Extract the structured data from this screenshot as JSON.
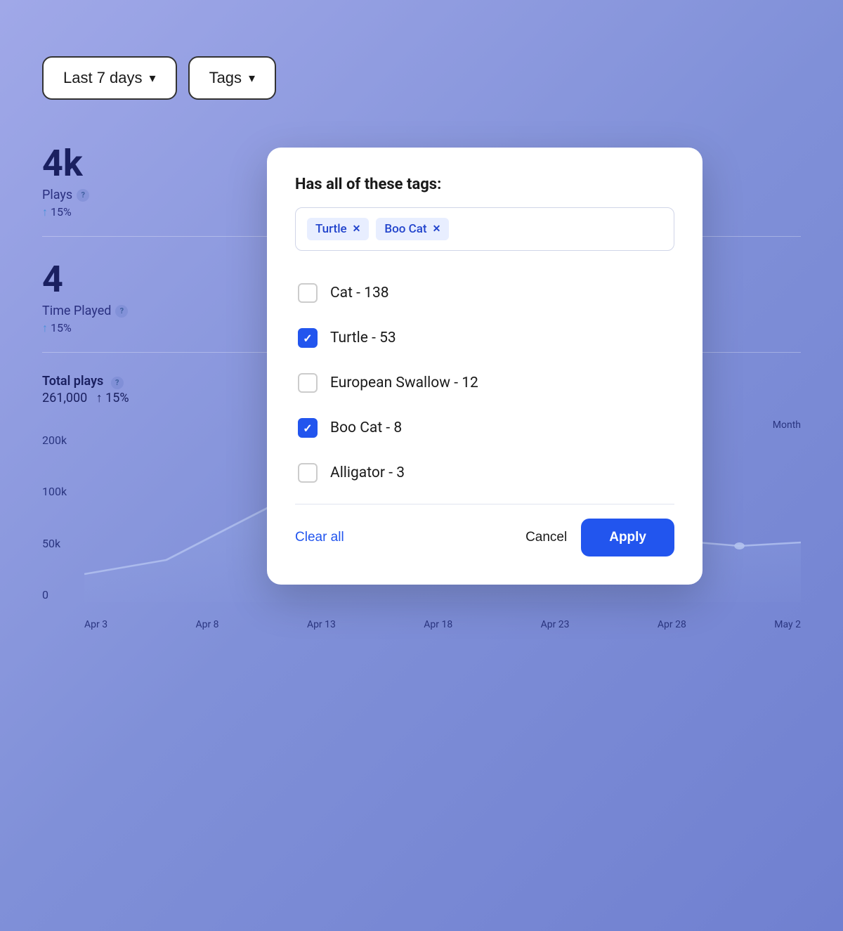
{
  "filter_bar": {
    "date_filter_label": "Last 7 days",
    "tags_filter_label": "Tags",
    "chevron": "▾"
  },
  "stats": {
    "plays_value": "4k",
    "plays_label": "Plays",
    "plays_change": "↑ 15%",
    "time_played_value": "4",
    "time_played_label": "Time Played",
    "time_played_change": "↑ 15%",
    "total_plays_label": "Total plays",
    "total_plays_value": "261,000",
    "total_plays_change": "↑ 15%"
  },
  "chart": {
    "y_labels": [
      "200k",
      "100k",
      "50k",
      "0"
    ],
    "x_labels": [
      "Apr 3",
      "Apr 8",
      "Apr 13",
      "Apr 18",
      "Apr 23",
      "Apr 28",
      "May 2"
    ],
    "month_label": "Month"
  },
  "modal": {
    "title": "Has all of these tags:",
    "selected_tags": [
      {
        "label": "Turtle",
        "id": "turtle"
      },
      {
        "label": "Boo Cat",
        "id": "boo-cat"
      }
    ],
    "checkbox_items": [
      {
        "label": "Cat",
        "count": 138,
        "checked": false,
        "id": "cat"
      },
      {
        "label": "Turtle",
        "count": 53,
        "checked": true,
        "id": "turtle"
      },
      {
        "label": "European Swallow",
        "count": 12,
        "checked": false,
        "id": "european-swallow"
      },
      {
        "label": "Boo Cat",
        "count": 8,
        "checked": true,
        "id": "boo-cat"
      },
      {
        "label": "Alligator",
        "count": 3,
        "checked": false,
        "id": "alligator"
      }
    ],
    "clear_all_label": "Clear all",
    "cancel_label": "Cancel",
    "apply_label": "Apply"
  }
}
